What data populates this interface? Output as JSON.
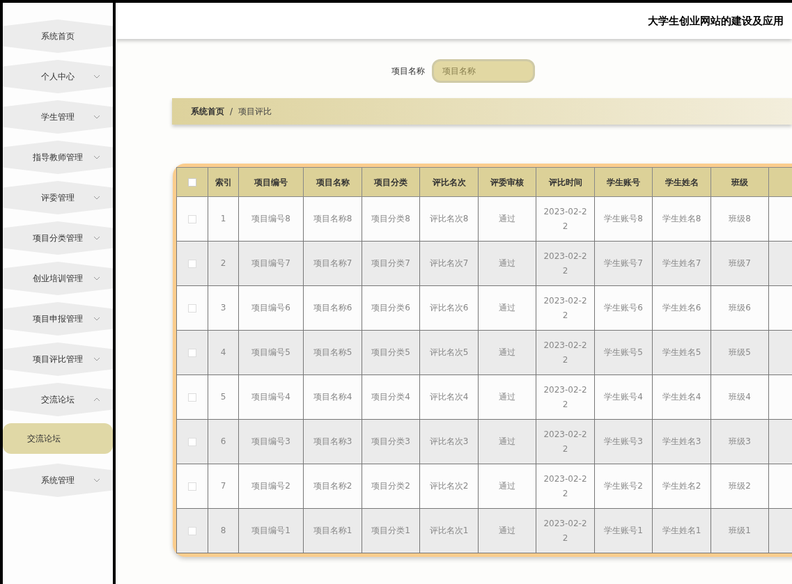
{
  "header": {
    "title": "大学生创业网站的建设及应用"
  },
  "sidebar": {
    "items": [
      {
        "label": "系统首页",
        "kind": "link"
      },
      {
        "label": "个人中心",
        "kind": "group",
        "expanded": false
      },
      {
        "label": "学生管理",
        "kind": "group",
        "expanded": false
      },
      {
        "label": "指导教师管理",
        "kind": "group",
        "expanded": false
      },
      {
        "label": "评委管理",
        "kind": "group",
        "expanded": false
      },
      {
        "label": "项目分类管理",
        "kind": "group",
        "expanded": false
      },
      {
        "label": "创业培训管理",
        "kind": "group",
        "expanded": false
      },
      {
        "label": "项目申报管理",
        "kind": "group",
        "expanded": false
      },
      {
        "label": "项目评比管理",
        "kind": "group",
        "expanded": false
      },
      {
        "label": "交流论坛",
        "kind": "group",
        "expanded": true,
        "children": [
          {
            "label": "交流论坛",
            "selected": true
          }
        ]
      },
      {
        "label": "系统管理",
        "kind": "group",
        "expanded": false
      }
    ]
  },
  "search": {
    "label": "项目名称",
    "placeholder": "项目名称"
  },
  "breadcrumb": [
    "系统首页",
    "/",
    "项目评比"
  ],
  "table": {
    "all_checked": false,
    "columns": [
      "索引",
      "项目编号",
      "项目名称",
      "项目分类",
      "评比名次",
      "评委审核",
      "评比时间",
      "学生账号",
      "学生姓名",
      "班级"
    ],
    "rows": [
      {
        "checked": false,
        "cells": [
          "1",
          "项目编号8",
          "项目名称8",
          "项目分类8",
          "评比名次8",
          "通过",
          "2023-02-22",
          "学生账号8",
          "学生姓名8",
          "班级8"
        ]
      },
      {
        "checked": false,
        "cells": [
          "2",
          "项目编号7",
          "项目名称7",
          "项目分类7",
          "评比名次7",
          "通过",
          "2023-02-22",
          "学生账号7",
          "学生姓名7",
          "班级7"
        ]
      },
      {
        "checked": false,
        "cells": [
          "3",
          "项目编号6",
          "项目名称6",
          "项目分类6",
          "评比名次6",
          "通过",
          "2023-02-22",
          "学生账号6",
          "学生姓名6",
          "班级6"
        ]
      },
      {
        "checked": false,
        "cells": [
          "4",
          "项目编号5",
          "项目名称5",
          "项目分类5",
          "评比名次5",
          "通过",
          "2023-02-22",
          "学生账号5",
          "学生姓名5",
          "班级5"
        ]
      },
      {
        "checked": false,
        "cells": [
          "5",
          "项目编号4",
          "项目名称4",
          "项目分类4",
          "评比名次4",
          "通过",
          "2023-02-22",
          "学生账号4",
          "学生姓名4",
          "班级4"
        ]
      },
      {
        "checked": false,
        "cells": [
          "6",
          "项目编号3",
          "项目名称3",
          "项目分类3",
          "评比名次3",
          "通过",
          "2023-02-22",
          "学生账号3",
          "学生姓名3",
          "班级3"
        ]
      },
      {
        "checked": false,
        "cells": [
          "7",
          "项目编号2",
          "项目名称2",
          "项目分类2",
          "评比名次2",
          "通过",
          "2023-02-22",
          "学生账号2",
          "学生姓名2",
          "班级2"
        ]
      },
      {
        "checked": false,
        "cells": [
          "8",
          "项目编号1",
          "项目名称1",
          "项目分类1",
          "评比名次1",
          "通过",
          "2023-02-22",
          "学生账号1",
          "学生姓名1",
          "班级1"
        ]
      }
    ]
  }
}
